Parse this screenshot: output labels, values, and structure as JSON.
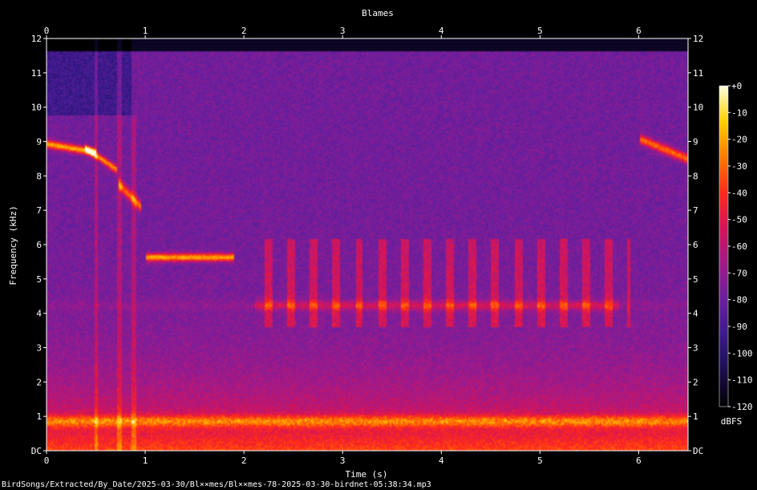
{
  "chart_data": {
    "type": "heatmap",
    "title": "Blames",
    "xlabel": "Time (s)",
    "ylabel": "Frequency (kHz)",
    "xlim": [
      0,
      6.5
    ],
    "ylim": [
      0,
      12
    ],
    "x_ticks": [
      "0",
      "1",
      "2",
      "3",
      "4",
      "5",
      "6"
    ],
    "y_ticks": [
      "DC",
      "1",
      "2",
      "3",
      "4",
      "5",
      "6",
      "7",
      "8",
      "9",
      "10",
      "11",
      "12"
    ],
    "colorbar": {
      "label": "dBFS",
      "range": [
        -120,
        0
      ],
      "ticks": [
        "+0",
        "-10",
        "-20",
        "-30",
        "-40",
        "-50",
        "-60",
        "-70",
        "-80",
        "-90",
        "-100",
        "-110",
        "-120"
      ]
    },
    "colormap": [
      "#000000",
      "#1a0d4d",
      "#3b1a8c",
      "#6a1f9e",
      "#a01a8a",
      "#d4145a",
      "#ff2a1a",
      "#ff7a00",
      "#ffd000",
      "#ffffe0"
    ],
    "background": "#000000",
    "filename": "BirdSongs/Extracted/By_Date/2025-03-30/Bl××mes/Bl××mes-78-2025-03-30-birdnet-05:38:34.mp3"
  }
}
